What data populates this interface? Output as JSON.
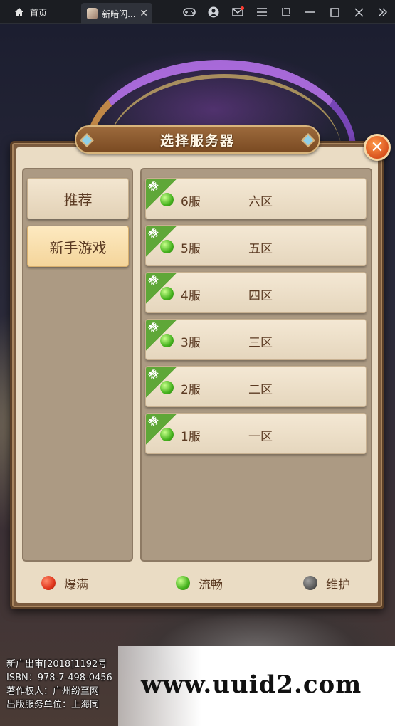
{
  "window": {
    "home_tab_label": "首页",
    "game_tab_label": "新暗闪...",
    "tab_close_glyph": "✕",
    "toolbar_icons": [
      "gamepad-icon",
      "user-icon",
      "mail-icon",
      "menu-icon",
      "crop-icon",
      "minimize-icon",
      "maximize-icon",
      "close-icon",
      "collapse-icon"
    ]
  },
  "dialog": {
    "title": "选择服务器",
    "close_glyph": "✕",
    "categories": [
      {
        "label": "推荐",
        "active": false
      },
      {
        "label": "新手游戏",
        "active": true
      }
    ],
    "recommend_tag": "荐",
    "servers": [
      {
        "num": "6服",
        "zone": "六区",
        "status": "smooth"
      },
      {
        "num": "5服",
        "zone": "五区",
        "status": "smooth"
      },
      {
        "num": "4服",
        "zone": "四区",
        "status": "smooth"
      },
      {
        "num": "3服",
        "zone": "三区",
        "status": "smooth"
      },
      {
        "num": "2服",
        "zone": "二区",
        "status": "smooth"
      },
      {
        "num": "1服",
        "zone": "一区",
        "status": "smooth"
      }
    ],
    "legend": [
      {
        "label": "爆满",
        "color": "#e0361c"
      },
      {
        "label": "流畅",
        "color": "#45b21d"
      },
      {
        "label": "维护",
        "color": "#5a5a5a"
      }
    ]
  },
  "license_lines": [
    "新广出审[2018]1192号",
    "ISBN：978-7-498-0456",
    "著作权人：广州纷至网",
    "出版服务单位：上海同"
  ],
  "watermark": "www.uuid2.com",
  "colors": {
    "accent_green": "#45b21d",
    "panel_brown": "#7b5b3e",
    "text_brown": "#5b3a22"
  }
}
